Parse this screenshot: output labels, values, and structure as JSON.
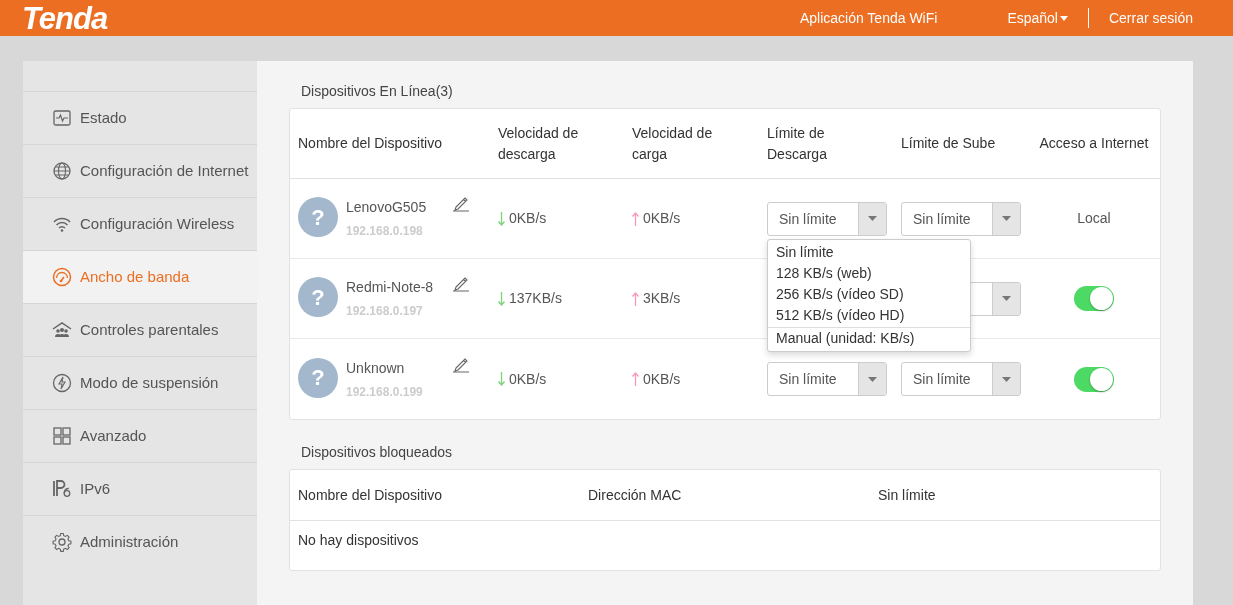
{
  "header": {
    "logo": "Tenda",
    "links": [
      {
        "label": "Aplicación Tenda WiFi",
        "kind": "link"
      },
      {
        "label": "Español",
        "kind": "language"
      },
      {
        "label": "Cerrar sesión",
        "kind": "link"
      }
    ]
  },
  "sidebar": {
    "items": [
      {
        "label": "Estado",
        "selected": false
      },
      {
        "label": "Configuración de Internet",
        "selected": false
      },
      {
        "label": "Configuración Wireless",
        "selected": false
      },
      {
        "label": "Ancho de banda",
        "selected": true
      },
      {
        "label": "Controles parentales",
        "selected": false
      },
      {
        "label": "Modo de suspensión",
        "selected": false
      },
      {
        "label": "Avanzado",
        "selected": false
      },
      {
        "label": "IPv6",
        "selected": false
      },
      {
        "label": "Administración",
        "selected": false
      }
    ]
  },
  "online": {
    "title": "Dispositivos En Línea(3)",
    "columns": [
      "Nombre del Dispositivo",
      "Velocidad de descarga",
      "Velocidad de carga",
      "Límite de Descarga",
      "Límite de Sube",
      "Acceso a Internet"
    ],
    "rows": [
      {
        "avatar": "?",
        "name": "LenovoG505",
        "ip": "192.168.0.198",
        "download": "0KB/s",
        "upload": "0KB/s",
        "download_limit": {
          "value": "Sin límite",
          "open": true
        },
        "upload_limit": {
          "value": "Sin límite"
        },
        "access": {
          "kind": "text",
          "label": "Local"
        }
      },
      {
        "avatar": "?",
        "name": "Redmi-Note-8",
        "ip": "192.168.0.197",
        "download": "137KB/s",
        "upload": "3KB/s",
        "download_limit": {},
        "upload_limit": {},
        "access": {
          "kind": "toggle",
          "on": true
        }
      },
      {
        "avatar": "?",
        "name": "Unknown",
        "ip": "192.168.0.199",
        "download": "0KB/s",
        "upload": "0KB/s",
        "download_limit": {
          "value": "Sin límite"
        },
        "upload_limit": {
          "value": "Sin límite"
        },
        "access": {
          "kind": "toggle",
          "on": true
        }
      }
    ],
    "dropdown": {
      "options": [
        {
          "label": "Sin límite",
          "kind": "preset"
        },
        {
          "label": "128 KB/s (web)",
          "kind": "preset"
        },
        {
          "label": "256 KB/s (vídeo SD)",
          "kind": "preset"
        },
        {
          "label": "512 KB/s (vídeo HD)",
          "kind": "preset"
        },
        {
          "label": "Manual (unidad: KB/s)",
          "kind": "manual"
        }
      ]
    }
  },
  "blocked": {
    "title": "Dispositivos bloqueados",
    "columns": [
      "Nombre del Dispositivo",
      "Dirección MAC",
      "Sin límite"
    ],
    "empty_text": "No hay dispositivos"
  }
}
